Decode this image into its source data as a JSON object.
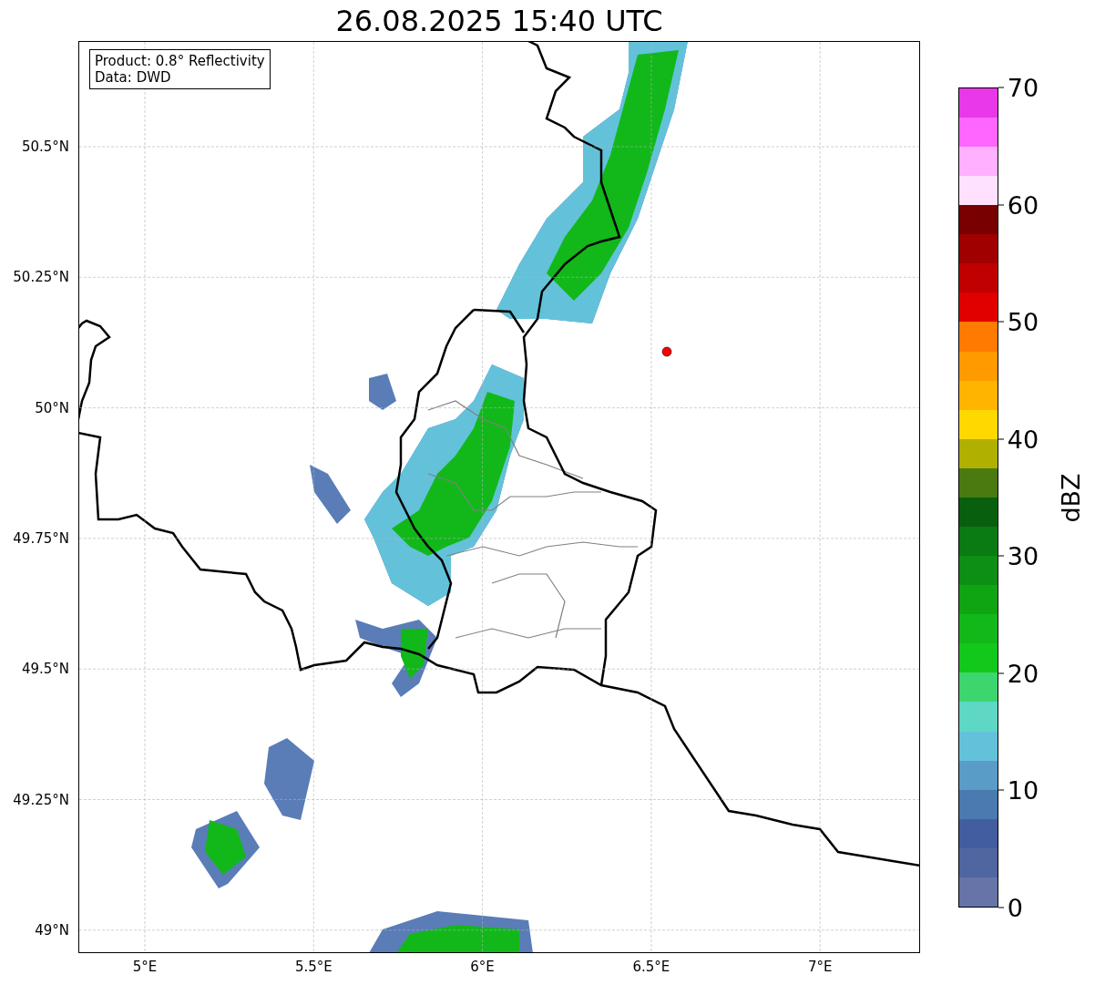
{
  "title": "26.08.2025 15:40 UTC",
  "info_box": {
    "lines": [
      "Product: 0.8° Reflectivity",
      "Data: DWD"
    ]
  },
  "lat_ticks": [
    "50.5°N",
    "50.25°N",
    "50°N",
    "49.75°N",
    "49.5°N",
    "49.25°N",
    "49°N"
  ],
  "lon_ticks": [
    "5°E",
    "5.5°E",
    "6°E",
    "6.5°E",
    "7°E"
  ],
  "colorbar": {
    "label": "dBZ",
    "ticks": [
      "70",
      "60",
      "50",
      "40",
      "30",
      "20",
      "10",
      "0"
    ],
    "segments": [
      {
        "color": "#6674a8"
      },
      {
        "color": "#5066a0"
      },
      {
        "color": "#435ea0"
      },
      {
        "color": "#4a7ab0"
      },
      {
        "color": "#5a9cc8"
      },
      {
        "color": "#63c2da"
      },
      {
        "color": "#5ed8c4"
      },
      {
        "color": "#3dd66e"
      },
      {
        "color": "#12c81a"
      },
      {
        "color": "#12b81a"
      },
      {
        "color": "#0fa512"
      },
      {
        "color": "#0c8f14"
      },
      {
        "color": "#0a7a12"
      },
      {
        "color": "#08600e"
      },
      {
        "color": "#4a7a10"
      },
      {
        "color": "#b0b000"
      },
      {
        "color": "#ffd800"
      },
      {
        "color": "#ffb400"
      },
      {
        "color": "#ff9a00"
      },
      {
        "color": "#ff7a00"
      },
      {
        "color": "#e00000"
      },
      {
        "color": "#c00000"
      },
      {
        "color": "#a00000"
      },
      {
        "color": "#780000"
      },
      {
        "color": "#ffe0ff"
      },
      {
        "color": "#ffb0ff"
      },
      {
        "color": "#ff66ff"
      },
      {
        "color": "#e838e8"
      }
    ]
  }
}
